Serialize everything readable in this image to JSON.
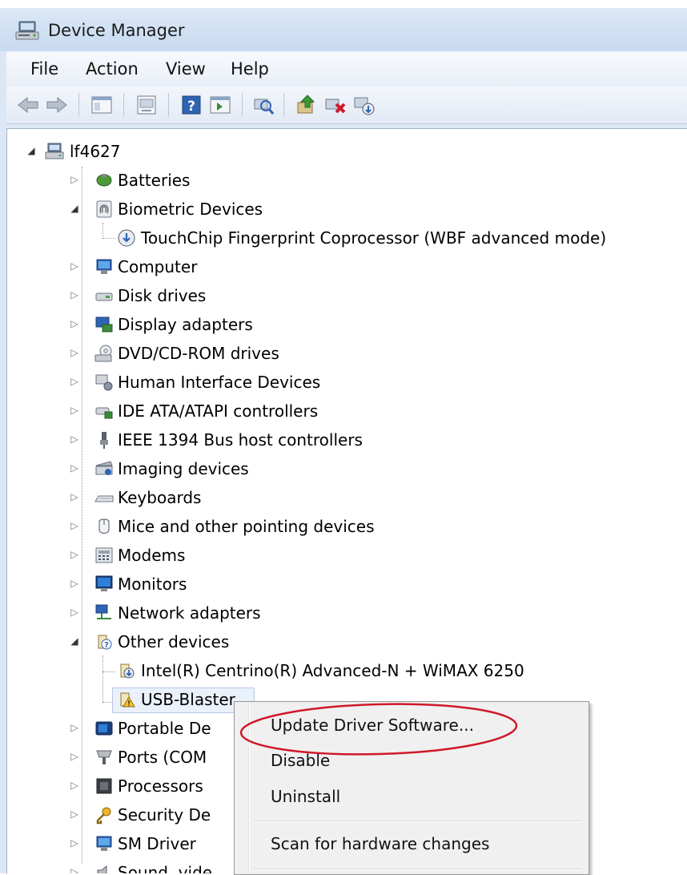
{
  "window": {
    "title": "Device Manager",
    "icon": "device-manager-icon"
  },
  "menu": [
    "File",
    "Action",
    "View",
    "Help"
  ],
  "toolbar": {
    "buttons": [
      "back-arrow-icon",
      "forward-arrow-icon",
      "show-hide-console-tree-icon",
      "properties-icon",
      "help-icon",
      "show-hide-action-pane-icon",
      "scan-hardware-icon",
      "update-driver-icon",
      "uninstall-device-icon",
      "disable-device-icon"
    ]
  },
  "tree": {
    "root": "lf4627",
    "items": [
      {
        "label": "Batteries",
        "expanded": false
      },
      {
        "label": "Biometric Devices",
        "expanded": true,
        "children": [
          "TouchChip Fingerprint Coprocessor (WBF advanced mode)"
        ]
      },
      {
        "label": "Computer",
        "expanded": false
      },
      {
        "label": "Disk drives",
        "expanded": false
      },
      {
        "label": "Display adapters",
        "expanded": false
      },
      {
        "label": "DVD/CD-ROM drives",
        "expanded": false
      },
      {
        "label": "Human Interface Devices",
        "expanded": false
      },
      {
        "label": "IDE ATA/ATAPI controllers",
        "expanded": false
      },
      {
        "label": "IEEE 1394 Bus host controllers",
        "expanded": false
      },
      {
        "label": "Imaging devices",
        "expanded": false
      },
      {
        "label": "Keyboards",
        "expanded": false
      },
      {
        "label": "Mice and other pointing devices",
        "expanded": false
      },
      {
        "label": "Modems",
        "expanded": false
      },
      {
        "label": "Monitors",
        "expanded": false
      },
      {
        "label": "Network adapters",
        "expanded": false
      },
      {
        "label": "Other devices",
        "expanded": true,
        "children": [
          "Intel(R) Centrino(R) Advanced-N + WiMAX 6250",
          "USB-Blaster"
        ]
      },
      {
        "label": "Portable De",
        "expanded": false
      },
      {
        "label": "Ports (COM",
        "expanded": false
      },
      {
        "label": "Processors",
        "expanded": false
      },
      {
        "label": "Security De",
        "expanded": false
      },
      {
        "label": "SM Driver",
        "expanded": false
      },
      {
        "label": "Sound, vide",
        "expanded": false
      }
    ]
  },
  "context_menu": {
    "items": [
      "Update Driver Software...",
      "Disable",
      "Uninstall",
      "Scan for hardware changes"
    ],
    "highlight_color": "#d0182a"
  }
}
